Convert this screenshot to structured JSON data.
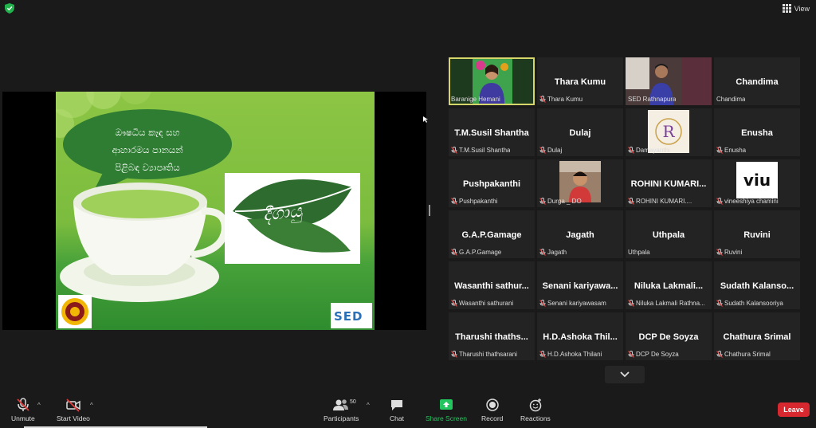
{
  "top": {
    "view_label": "View"
  },
  "slide": {
    "bubble_lines": [
      "ඖෂධීය කෑඳ සහ",
      "ආහාරමය පානයන්",
      "පිළිබඳ ව්‍යාපෘතිය"
    ],
    "logo_text": "දීගායු",
    "sed_logo_text": "SED"
  },
  "gallery": {
    "tiles": [
      {
        "big": "",
        "foot": "Baranige Hemani",
        "muted": false,
        "type": "photo-woman",
        "active": true
      },
      {
        "big": "Thara Kumu",
        "foot": "Thara Kumu",
        "muted": true
      },
      {
        "big": "",
        "foot": "SED Rathnapura",
        "muted": false,
        "type": "photo-man"
      },
      {
        "big": "Chandima",
        "foot": "Chandima",
        "muted": false
      },
      {
        "big": "T.M.Susil Shantha",
        "foot": "T.M.Susil Shantha",
        "muted": true
      },
      {
        "big": "Dulaj",
        "foot": "Dulaj",
        "muted": true
      },
      {
        "big": "",
        "foot": "Damayanthi",
        "muted": true,
        "type": "logo-r"
      },
      {
        "big": "Enusha",
        "foot": "Enusha",
        "muted": true
      },
      {
        "big": "Pushpakanthi",
        "foot": "Pushpakanthi",
        "muted": true
      },
      {
        "big": "",
        "foot": "Durga _ DO",
        "muted": true,
        "type": "photo-child"
      },
      {
        "big": "ROHINI KUMARI...",
        "foot": "ROHINI KUMARI....",
        "muted": true
      },
      {
        "big": "",
        "foot": "vineeshiya chamini",
        "muted": true,
        "type": "logo-viu"
      },
      {
        "big": "G.A.P.Gamage",
        "foot": "G.A.P.Gamage",
        "muted": true
      },
      {
        "big": "Jagath",
        "foot": "Jagath",
        "muted": true
      },
      {
        "big": "Uthpala",
        "foot": "Uthpala",
        "muted": false
      },
      {
        "big": "Ruvini",
        "foot": "Ruvini",
        "muted": true
      },
      {
        "big": "Wasanthi sathur...",
        "foot": "Wasanthi sathurani",
        "muted": true
      },
      {
        "big": "Senani kariyawa...",
        "foot": "Senani kariyawasam",
        "muted": true
      },
      {
        "big": "Niluka Lakmali...",
        "foot": "Niluka Lakmali Rathna...",
        "muted": true
      },
      {
        "big": "Sudath Kalanso...",
        "foot": "Sudath Kalansooriya",
        "muted": true
      },
      {
        "big": "Tharushi thaths...",
        "foot": "Tharushi thathsarani",
        "muted": true
      },
      {
        "big": "H.D.Ashoka Thil...",
        "foot": "H.D.Ashoka Thilani",
        "muted": true
      },
      {
        "big": "DCP De Soyza",
        "foot": "DCP De Soyza",
        "muted": true
      },
      {
        "big": "Chathura Srimal",
        "foot": "Chathura Srimal",
        "muted": true
      }
    ]
  },
  "toolbar": {
    "unmute": "Unmute",
    "start_video": "Start Video",
    "participants": "Participants",
    "participants_count": "50",
    "chat": "Chat",
    "share_screen": "Share Screen",
    "record": "Record",
    "reactions": "Reactions",
    "leave": "Leave"
  },
  "colors": {
    "active_speaker": "#d6d66a",
    "share_green": "#22c55e",
    "leave_red": "#d7282f",
    "mute_red": "#e03b3b"
  }
}
